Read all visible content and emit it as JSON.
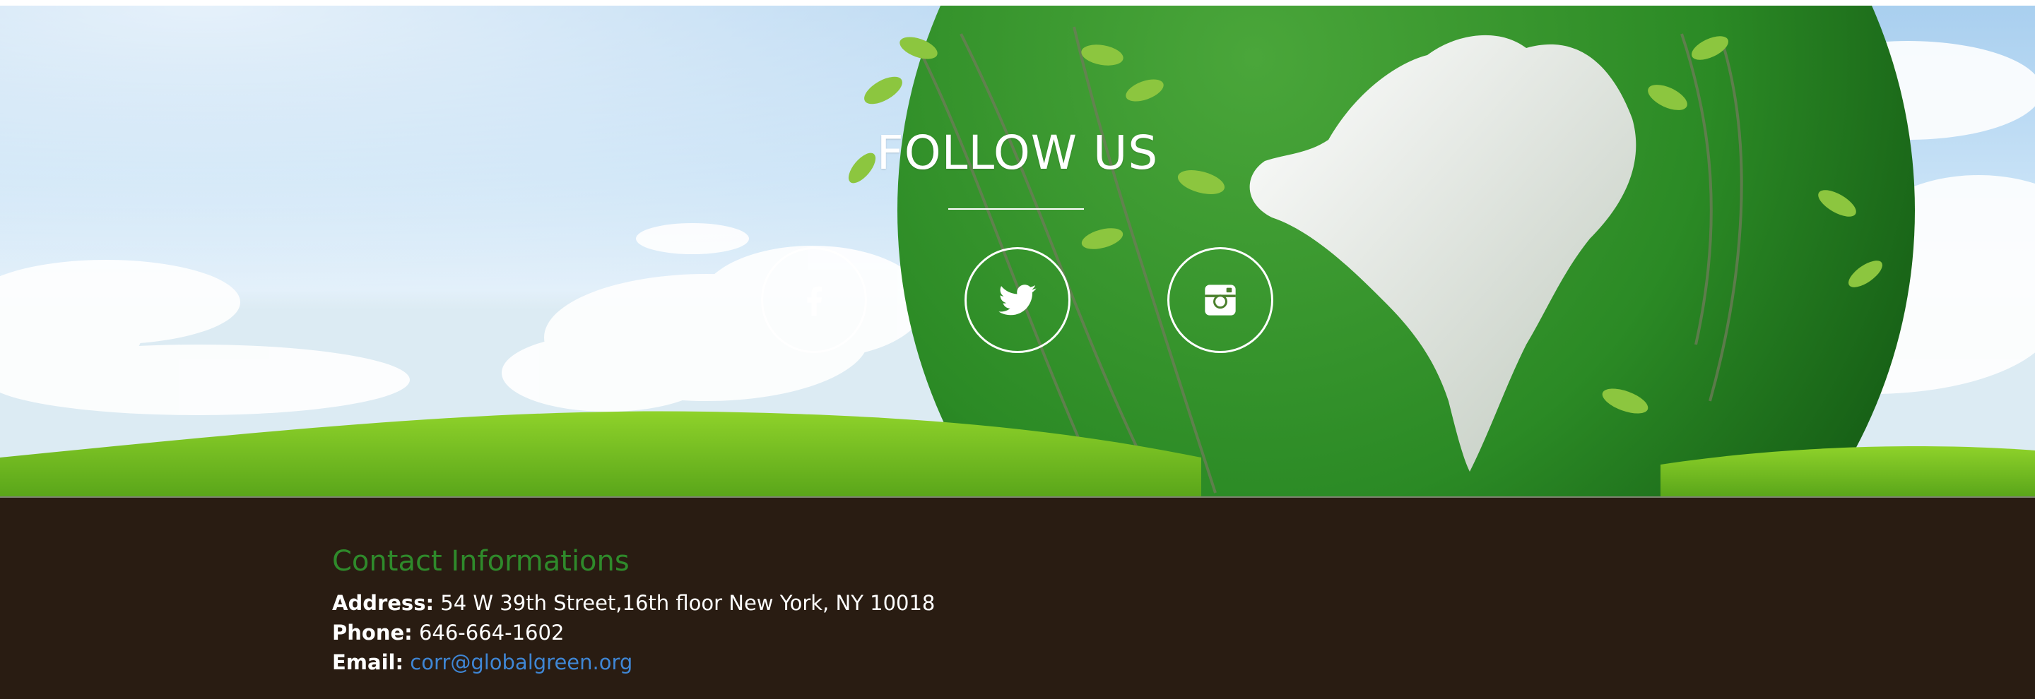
{
  "follow": {
    "title": "FOLLOW US",
    "social": [
      {
        "name": "facebook",
        "icon": "facebook-icon"
      },
      {
        "name": "twitter",
        "icon": "twitter-icon"
      },
      {
        "name": "instagram",
        "icon": "instagram-icon"
      }
    ]
  },
  "contact": {
    "title": "Contact Informations",
    "address_label": "Address:",
    "address_value": "54 W 39th Street,16th floor New York, NY 10018",
    "phone_label": "Phone:",
    "phone_value": "646-664-1602",
    "email_label": "Email:",
    "email_value": "corr@globalgreen.org"
  },
  "colors": {
    "footer_bg": "#291c12",
    "contact_title": "#2f8a2b",
    "link": "#3f86d4",
    "grass": "#7cc520",
    "globe": "#2f8a2b"
  }
}
